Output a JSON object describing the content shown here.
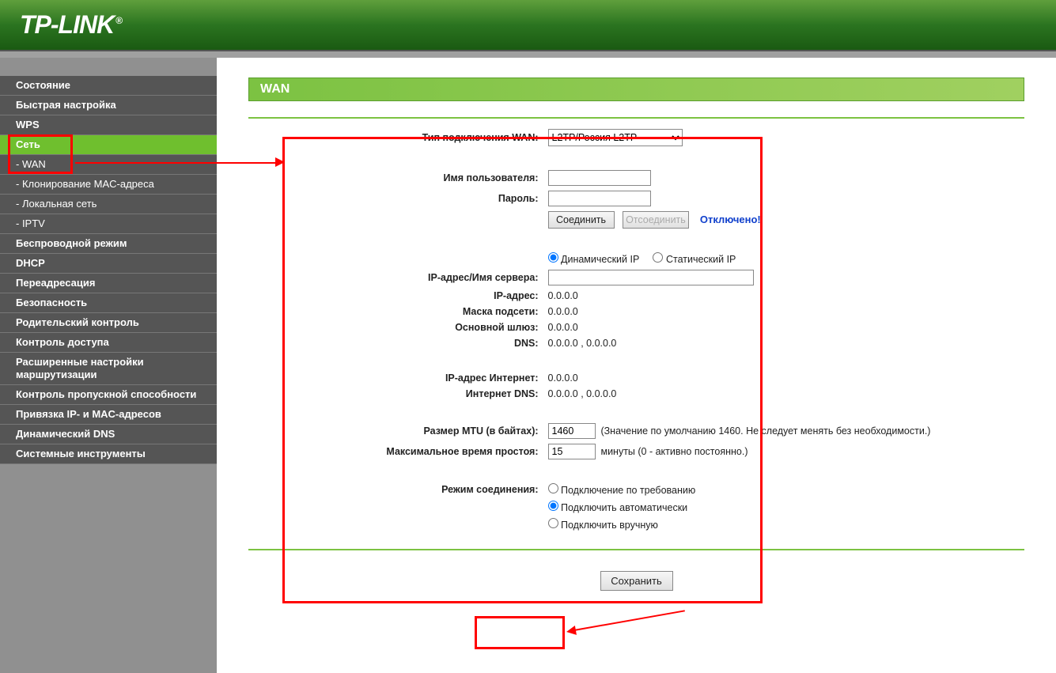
{
  "brand": "TP-LINK",
  "sidebar": {
    "items": [
      {
        "label": "Состояние",
        "sub": false,
        "active": false
      },
      {
        "label": "Быстрая настройка",
        "sub": false,
        "active": false
      },
      {
        "label": "WPS",
        "sub": false,
        "active": false
      },
      {
        "label": "Сеть",
        "sub": false,
        "active": true
      },
      {
        "label": "- WAN",
        "sub": true,
        "active": false,
        "subactive": true
      },
      {
        "label": "- Клонирование MAC-адреса",
        "sub": true,
        "active": false
      },
      {
        "label": "- Локальная сеть",
        "sub": true,
        "active": false
      },
      {
        "label": "- IPTV",
        "sub": true,
        "active": false
      },
      {
        "label": "Беспроводной режим",
        "sub": false,
        "active": false
      },
      {
        "label": "DHCP",
        "sub": false,
        "active": false
      },
      {
        "label": "Переадресация",
        "sub": false,
        "active": false
      },
      {
        "label": "Безопасность",
        "sub": false,
        "active": false
      },
      {
        "label": "Родительский контроль",
        "sub": false,
        "active": false
      },
      {
        "label": "Контроль доступа",
        "sub": false,
        "active": false
      },
      {
        "label": "Расширенные настройки маршрутизации",
        "sub": false,
        "active": false
      },
      {
        "label": "Контроль пропускной способности",
        "sub": false,
        "active": false
      },
      {
        "label": "Привязка IP- и MAC-адресов",
        "sub": false,
        "active": false
      },
      {
        "label": "Динамический DNS",
        "sub": false,
        "active": false
      },
      {
        "label": "Системные инструменты",
        "sub": false,
        "active": false
      }
    ]
  },
  "page": {
    "title": "WAN"
  },
  "form": {
    "wan_type_label": "Тип подключения WAN:",
    "wan_type_value": "L2TP/Россия L2TP",
    "username_label": "Имя пользователя:",
    "username_value": "",
    "password_label": "Пароль:",
    "password_value": "",
    "connect_btn": "Соединить",
    "disconnect_btn": "Отсоединить",
    "status_text": "Отключено!",
    "ipmode_dynamic": "Динамический IP",
    "ipmode_static": "Статический IP",
    "server_ip_label": "IP-адрес/Имя сервера:",
    "server_ip_value": "",
    "ip_addr_label": "IP-адрес:",
    "ip_addr_value": "0.0.0.0",
    "subnet_label": "Маска подсети:",
    "subnet_value": "0.0.0.0",
    "gateway_label": "Основной шлюз:",
    "gateway_value": "0.0.0.0",
    "dns_label": "DNS:",
    "dns_value": "0.0.0.0 , 0.0.0.0",
    "inet_ip_label": "IP-адрес Интернет:",
    "inet_ip_value": "0.0.0.0",
    "inet_dns_label": "Интернет DNS:",
    "inet_dns_value": "0.0.0.0 , 0.0.0.0",
    "mtu_label": "Размер MTU (в байтах):",
    "mtu_value": "1460",
    "mtu_hint": "(Значение по умолчанию 1460. Не следует менять без необходимости.)",
    "idle_label": "Максимальное время простоя:",
    "idle_value": "15",
    "idle_hint": "минуты (0 - активно постоянно.)",
    "connmode_label": "Режим соединения:",
    "connmode_demand": "Подключение по требованию",
    "connmode_auto": "Подключить автоматически",
    "connmode_manual": "Подключить вручную",
    "save_btn": "Сохранить"
  }
}
